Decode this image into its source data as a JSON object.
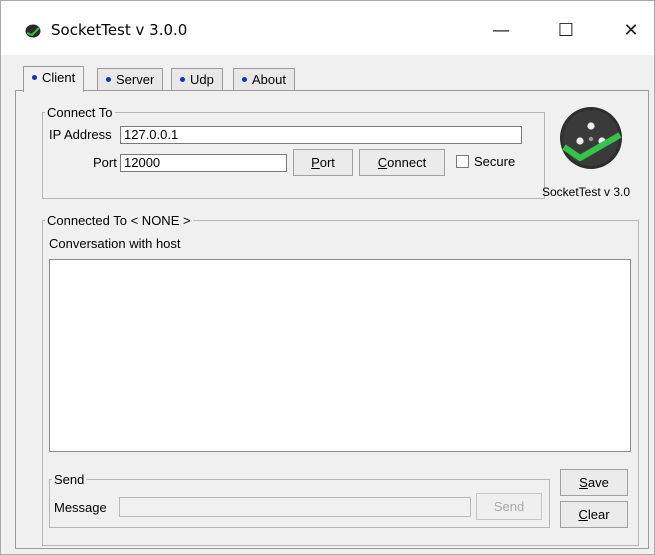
{
  "window": {
    "title": "SocketTest v 3.0.0",
    "minimize_glyph": "—",
    "maximize_glyph": "☐",
    "close_glyph": "✕"
  },
  "tabs": [
    {
      "label": "Client",
      "active": true
    },
    {
      "label": "Server",
      "active": false
    },
    {
      "label": "Udp",
      "active": false
    },
    {
      "label": "About",
      "active": false
    }
  ],
  "connect": {
    "legend": "Connect To",
    "ip_label": "IP Address",
    "ip_value": "127.0.0.1",
    "port_label": "Port",
    "port_value": "12000",
    "port_button_mnemonic": "P",
    "port_button_rest": "ort",
    "connect_button_mnemonic": "C",
    "connect_button_rest": "onnect",
    "secure_label": "Secure",
    "secure_checked": false
  },
  "logo": {
    "caption": "SocketTest v 3.0",
    "icon": "socket-check-icon"
  },
  "connected": {
    "legend": "Connected To < NONE >",
    "conversation_label": "Conversation with host",
    "conversation_text": ""
  },
  "send": {
    "legend": "Send",
    "message_label": "Message",
    "message_value": "",
    "send_button": "Send",
    "save_button_mnemonic": "S",
    "save_button_rest": "ave",
    "clear_button_mnemonic": "C",
    "clear_button_rest": "lear"
  },
  "colors": {
    "accent_green": "#37c34a",
    "tab_dot": "#1030c0"
  }
}
